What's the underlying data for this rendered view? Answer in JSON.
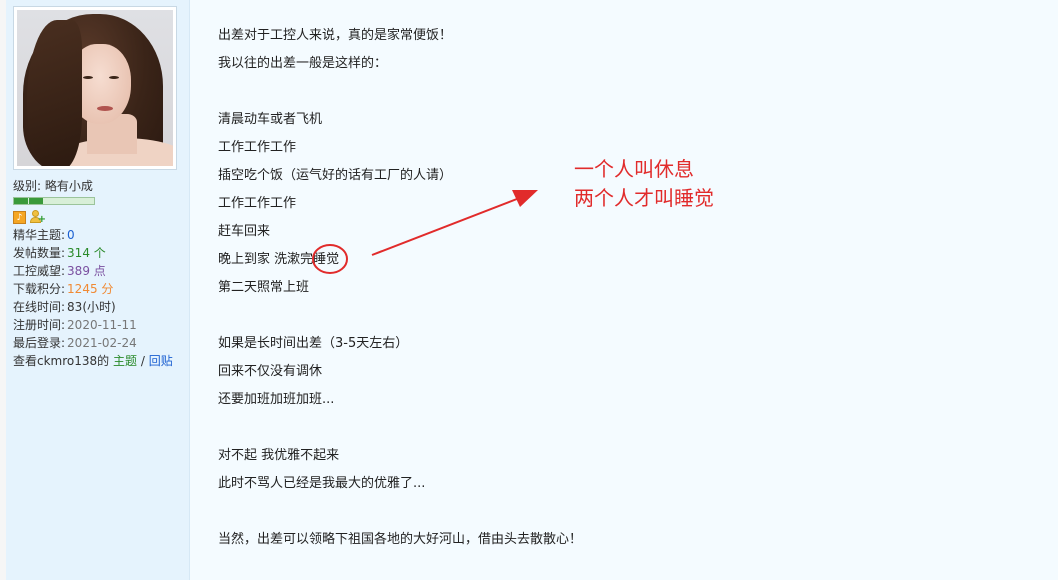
{
  "sidebar": {
    "level_label": "级别:",
    "level_value": "略有小成",
    "level_progress": 0.4,
    "stats": [
      {
        "label": "精华主题:",
        "value": "0",
        "color": "#1a5fd1"
      },
      {
        "label": "发帖数量:",
        "value": "314 个",
        "color": "#2a8a2a"
      },
      {
        "label": "工控威望:",
        "value": "389 点",
        "color": "#7a4fa0"
      },
      {
        "label": "下载积分:",
        "value": "1245 分",
        "color": "#f08a34"
      },
      {
        "label": "在线时间:",
        "value": "83(小时)",
        "color": "#333333"
      },
      {
        "label": "注册时间:",
        "value": "2020-11-11",
        "color": "#777777"
      },
      {
        "label": "最后登录:",
        "value": "2021-02-24",
        "color": "#777777"
      }
    ],
    "view_prefix": "查看ckmro138的",
    "topics_link": "主题",
    "separator": "/",
    "replies_link": "回贴",
    "icons": [
      "sound-icon",
      "add-friend-icon"
    ]
  },
  "post": {
    "lines": [
      "出差对于工控人来说，真的是家常便饭！",
      "我以往的出差一般是这样的：",
      "",
      "清晨动车或者飞机",
      "工作工作工作",
      "插空吃个饭（运气好的话有工厂的人请）",
      "工作工作工作",
      "赶车回来",
      "晚上到家 洗漱完睡觉",
      "第二天照常上班",
      "",
      "如果是长时间出差（3-5天左右）",
      "回来不仅没有调休",
      "还要加班加班加班...",
      "",
      "对不起 我优雅不起来",
      "此时不骂人已经是我最大的优雅了...",
      "",
      "当然，出差可以领略下祖国各地的大好河山，借由头去散散心！"
    ]
  },
  "annotation": {
    "line1": "一个人叫休息",
    "line2": "两个人才叫睡觉",
    "color": "#e12b2b"
  }
}
